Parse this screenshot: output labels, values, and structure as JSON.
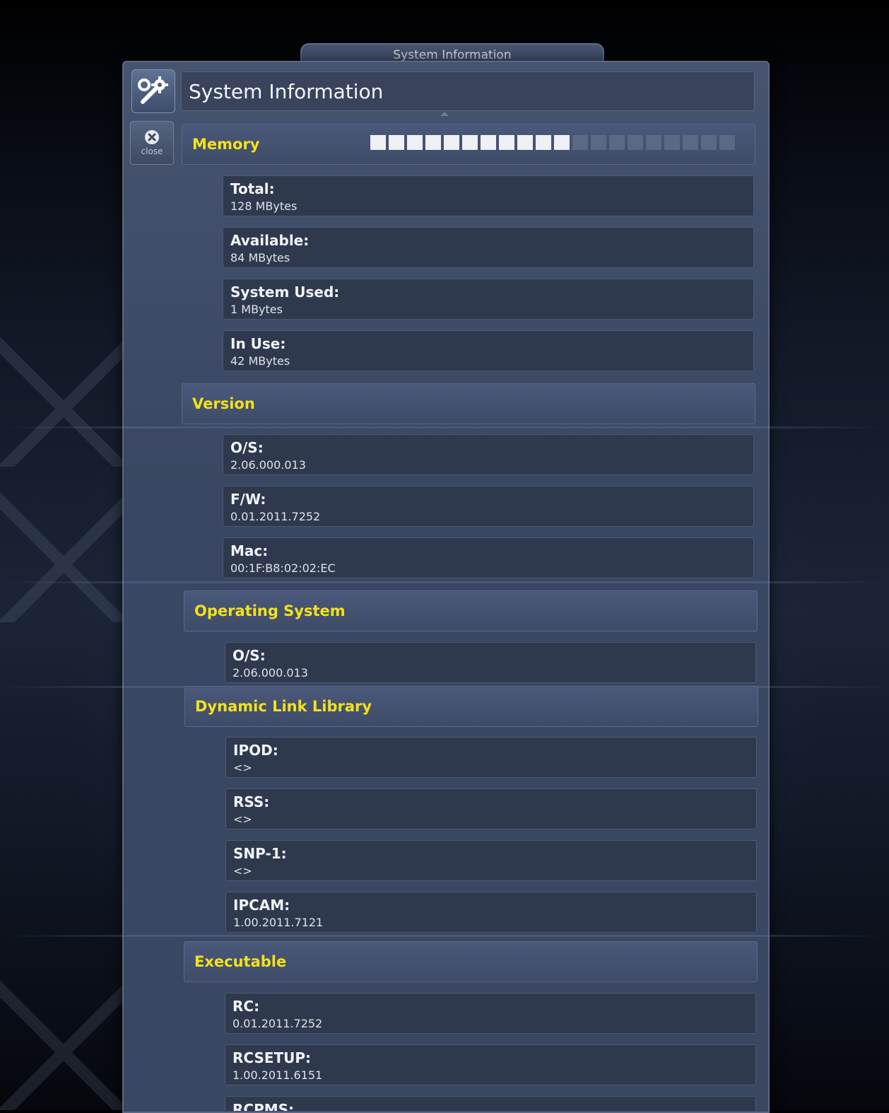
{
  "window": {
    "tab_title": "System Information",
    "header_title": "System Information",
    "close_label": "close"
  },
  "memory": {
    "label": "Memory",
    "meter": {
      "filled_segments": 11,
      "total_segments": 20
    },
    "rows": [
      {
        "key": "Total:",
        "value": "128 MBytes"
      },
      {
        "key": "Available:",
        "value": "84 MBytes"
      },
      {
        "key": "System Used:",
        "value": "1 MBytes"
      },
      {
        "key": "In Use:",
        "value": "42 MBytes"
      }
    ]
  },
  "version": {
    "label": "Version",
    "rows": [
      {
        "key": "O/S:",
        "value": "2.06.000.013"
      },
      {
        "key": "F/W:",
        "value": "0.01.2011.7252"
      },
      {
        "key": "Mac:",
        "value": "00:1F:B8:02:02:EC"
      }
    ]
  },
  "operating_system": {
    "label": "Operating System",
    "rows": [
      {
        "key": "O/S:",
        "value": "2.06.000.013"
      }
    ]
  },
  "dll": {
    "label": "Dynamic Link Library",
    "rows": [
      {
        "key": "IPOD:",
        "value": "<>"
      },
      {
        "key": "RSS:",
        "value": "<>"
      },
      {
        "key": "SNP-1:",
        "value": "<>"
      },
      {
        "key": "IPCAM:",
        "value": "1.00.2011.7121"
      }
    ]
  },
  "executable": {
    "label": "Executable",
    "rows": [
      {
        "key": "RC:",
        "value": "0.01.2011.7252"
      },
      {
        "key": "RCSETUP:",
        "value": "1.00.2011.6151"
      },
      {
        "key": "RCPMS:",
        "value": ""
      }
    ]
  }
}
